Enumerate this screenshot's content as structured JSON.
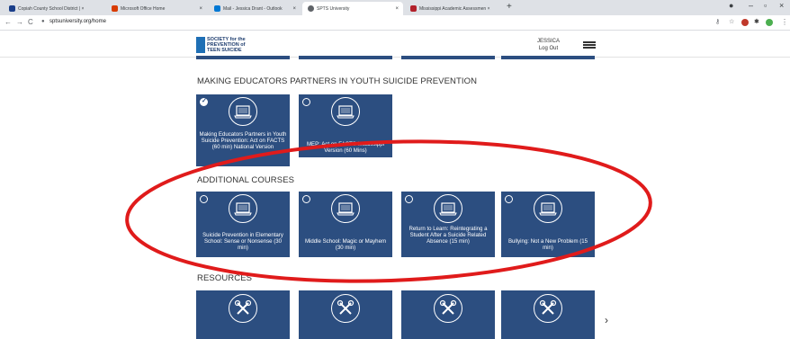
{
  "browser": {
    "tabs": [
      {
        "title": "Copiah County School District | ×",
        "fav_color": "#1a3e8a"
      },
      {
        "title": "Microsoft Office Home",
        "fav_color": "#d83b01"
      },
      {
        "title": "Mail - Jessica Drant - Outlook",
        "fav_color": "#0078d4"
      },
      {
        "title": "SPTS University",
        "fav_color": "#5f6368"
      },
      {
        "title": "Mississippi Academic Assessmen ×",
        "fav_color": "#b2202a"
      }
    ],
    "new_tab": "+",
    "url": "sptsuniversity.org/home",
    "back": "←",
    "forward": "→",
    "reload": "C",
    "lock": "🔒",
    "win_min": "–",
    "win_max": "▫",
    "win_close": "×"
  },
  "header": {
    "logo_lines": [
      "SOCIETY for the",
      "PREVENTION of",
      "TEEN SUICIDE"
    ],
    "user_name": "JESSICA",
    "logout": "Log Out"
  },
  "sections": {
    "mep_title": "MAKING EDUCATORS PARTNERS IN YOUTH SUICIDE PREVENTION",
    "additional_title": "ADDITIONAL COURSES",
    "resources_title": "RESOURCES"
  },
  "mep_tiles": [
    {
      "caption": "Making Educators Partners in Youth Suicide Prevention: Act on FACTS (60 min) National Version",
      "checked": true
    },
    {
      "caption": "MEP: Act on FACTS Mississippi Version (60 Mins)",
      "checked": false
    }
  ],
  "additional_tiles": [
    {
      "caption": "Suicide Prevention in Elementary School: Sense or Nonsense (30 min)"
    },
    {
      "caption": "Middle School: Magic or Mayhem (30 min)"
    },
    {
      "caption": "Return to Learn: Reintegrating a Student After a Suicide Related Absence (15 min)"
    },
    {
      "caption": "Bullying: Not a New Problem (15 min)"
    }
  ],
  "next_arrow": "›",
  "colors": {
    "tile": "#2c4e80",
    "annotation": "#e01b1b"
  }
}
